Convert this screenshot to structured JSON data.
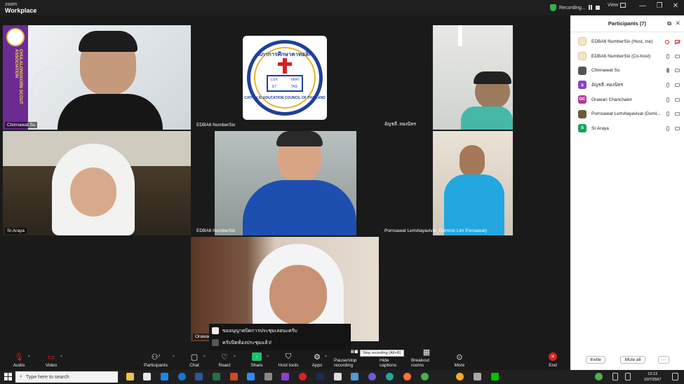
{
  "app": {
    "brand_top": "zoom",
    "brand_bottom": "Workplace"
  },
  "titlebar": {
    "recording_label": "Recording...",
    "view_label": "View",
    "minimize": "—",
    "maximize": "❐",
    "close": "✕"
  },
  "tiles": [
    {
      "name": "Chinnawat Su"
    },
    {
      "name": "EDBA6 NumberSix"
    },
    {
      "name": "อัญชลี..ทองนิทร"
    },
    {
      "name": "Sr.Araya"
    },
    {
      "name": "EDBA6 NumberSix"
    },
    {
      "name": "Pornsawat Lertvitayavivat_Dominic Lim Ponsawat)"
    },
    {
      "name": "Orawan"
    }
  ],
  "logo_text": {
    "scout": "CHULALONGKORN SCOUT ASSOCIATION",
    "cec_thai": "สภาการศึกษาคาทอลิก",
    "cec_en": "CATHOLIC EDUCATION COUNCIL OF THAILAND",
    "lux": "LUX",
    "veri": "VERI",
    "et": "ET",
    "tas": "TAS"
  },
  "captions": [
    {
      "text": "ขออนุญาตปิดการประชุมเลยนะครับ"
    },
    {
      "text": "ครับปิดห้องประชุมแล้ว!"
    }
  ],
  "participants": {
    "title": "Participants (7)",
    "items": [
      {
        "name": "EDBA6 NumberSix (Host, me)",
        "avatar_color": "#f2e6c8",
        "avatar_text": ""
      },
      {
        "name": "EDBA6 NumberSix (Co-host)",
        "avatar_color": "#f2e6c8",
        "avatar_text": ""
      },
      {
        "name": "Chinnawat Su",
        "avatar_color": "#555555",
        "avatar_text": ""
      },
      {
        "name": "อัญชลี..ทองนิทร",
        "avatar_color": "#8a3fd1",
        "avatar_text": "อ"
      },
      {
        "name": "Orawan Chanchalor",
        "avatar_color": "#b3379b",
        "avatar_text": "OC"
      },
      {
        "name": "Pornsawat Lertvitayavivat (Domi...",
        "avatar_color": "#6b5a3a",
        "avatar_text": ""
      },
      {
        "name": "Sr.Araya",
        "avatar_color": "#19a45a",
        "avatar_text": "S"
      }
    ],
    "invite": "Invite",
    "mute_all": "Mute all",
    "more": "···"
  },
  "toolbar": {
    "audio": "Audio",
    "video": "Video",
    "participants": "Participants",
    "participants_count": "7",
    "chat": "Chat",
    "react": "React",
    "share": "Share",
    "host_tools": "Host tools",
    "apps": "Apps",
    "pause_stop": "Pause/stop recording",
    "hide_captions": "Hide captions",
    "breakout": "Breakout rooms",
    "more": "More",
    "end": "End",
    "tooltip": "Stop recording (Alt+R)"
  },
  "taskbar": {
    "search_placeholder": "Type here to search",
    "time": "12:13",
    "date": "10/7/2567"
  },
  "colors": {
    "active_border": "#33d86a",
    "share_green": "#19c36b",
    "end_red": "#e02020"
  }
}
